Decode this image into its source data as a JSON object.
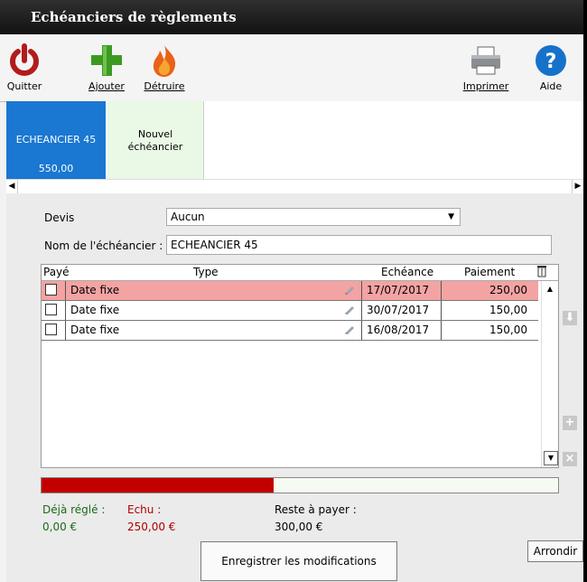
{
  "window": {
    "title": "Echéanciers de règlements"
  },
  "toolbar": {
    "quit": "Quitter",
    "add": "Ajouter",
    "destroy": "Détruire",
    "print": "Imprimer",
    "help": "Aide"
  },
  "tabs": {
    "active": {
      "name": "ECHEANCIER 45",
      "amount": "550,00"
    },
    "new": {
      "line1": "Nouvel",
      "line2": "échéancier"
    }
  },
  "form": {
    "devis_label": "Devis",
    "devis_value": "Aucun",
    "name_label": "Nom de l'échéancier :",
    "name_value": "ECHEANCIER 45"
  },
  "grid": {
    "headers": {
      "paid": "Payé",
      "type": "Type",
      "due": "Echéance",
      "payment": "Paiement"
    },
    "rows": [
      {
        "type": "Date fixe",
        "date": "17/07/2017",
        "amount": "250,00",
        "selected": true
      },
      {
        "type": "Date fixe",
        "date": "30/07/2017",
        "amount": "150,00",
        "selected": false
      },
      {
        "type": "Date fixe",
        "date": "16/08/2017",
        "amount": "150,00",
        "selected": false
      }
    ]
  },
  "progress": {
    "paid_fraction": 0.45
  },
  "summary": {
    "paid_label": "Déjà réglé :",
    "paid_value": "0,00 €",
    "due_label": "Echu :",
    "due_value": "250,00 €",
    "remaining_label": "Reste à payer :",
    "remaining_value": "300,00 €"
  },
  "buttons": {
    "save": "Enregistrer les modifications",
    "round": "Arrondir"
  },
  "colors": {
    "accent": "#1a77d2",
    "selected_row": "#f4a3a3",
    "progress_fill": "#c30000",
    "paid_text": "#1a6b1a",
    "due_text": "#b00000"
  }
}
